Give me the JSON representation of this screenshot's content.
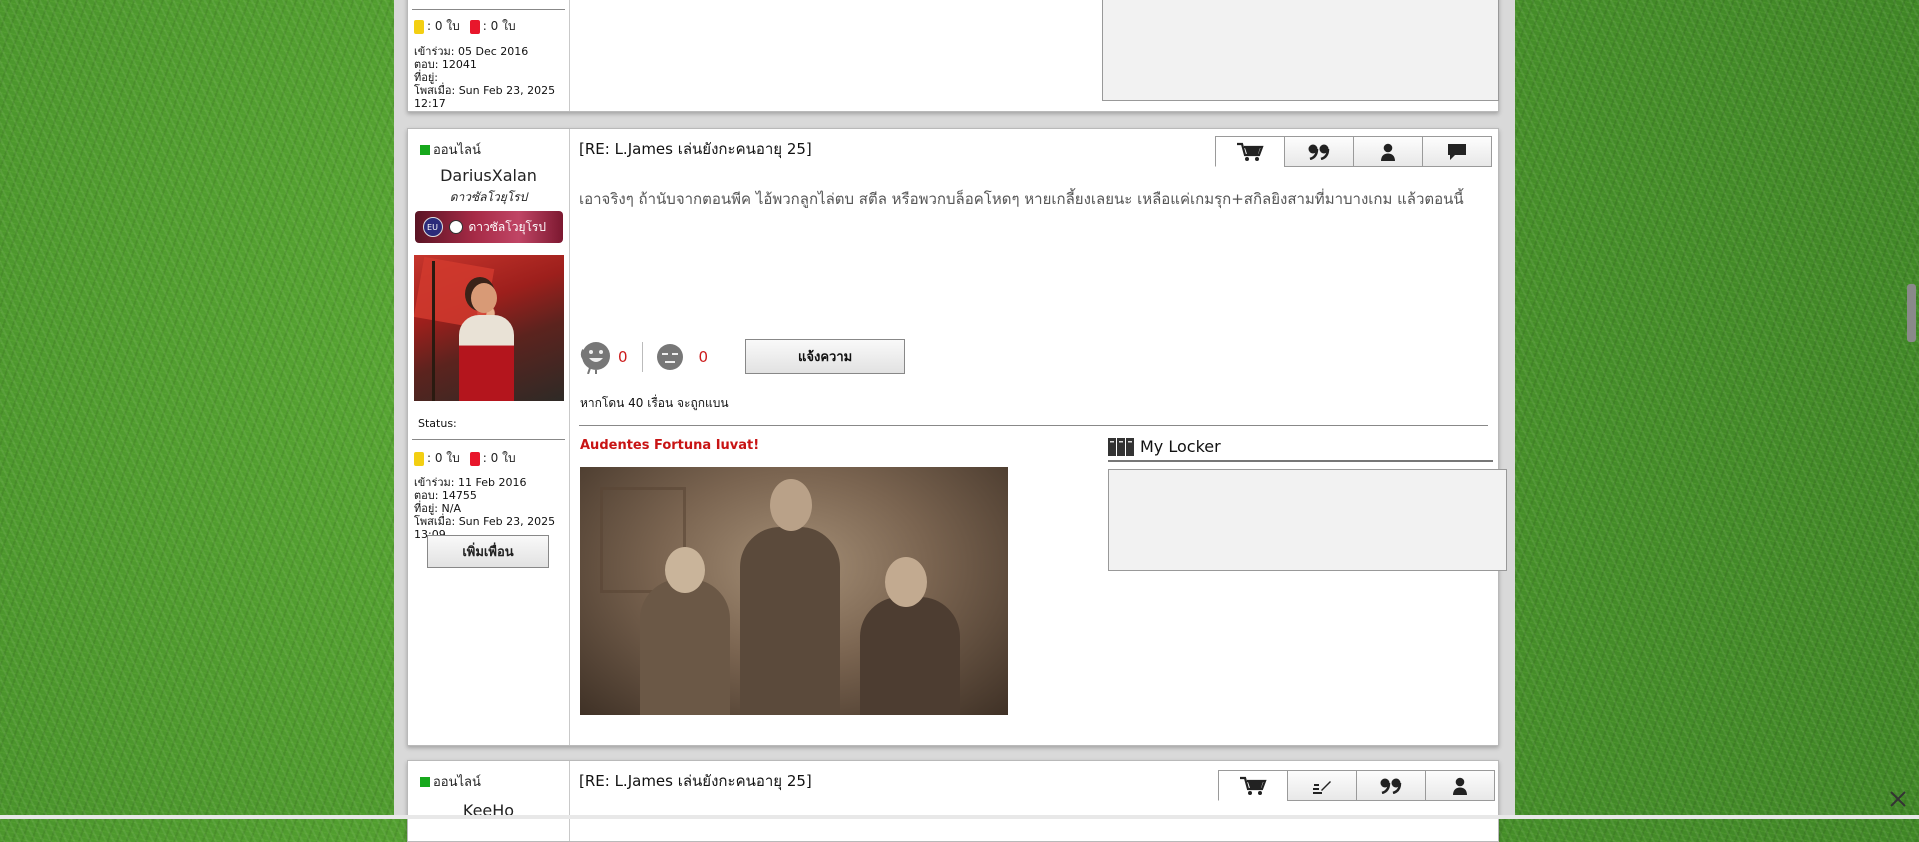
{
  "post_top": {
    "yellow_cards": ": 0 ใบ",
    "red_cards": ": 0 ใบ",
    "joined": "เข้าร่วม: 05 Dec 2016",
    "replies": "ตอบ: 12041",
    "location": "ที่อยู่:",
    "posted": "โพสเมื่อ: Sun Feb 23, 2025 12:17"
  },
  "post_main": {
    "online_label": "ออนไลน์",
    "username": "DariusXalan",
    "rank": "ดาวซัลโวยุโรป",
    "badge_eu": "EU",
    "badge_text": "ดาวซัลโวยุโรป",
    "status_label": "Status:",
    "yellow_cards": ": 0 ใบ",
    "red_cards": ": 0 ใบ",
    "joined": "เข้าร่วม: 11 Feb 2016",
    "replies": "ตอบ: 14755",
    "location": "ที่อยู่: N/A",
    "posted": "โพสเมื่อ: Sun Feb 23, 2025 13:09",
    "add_friend": "เพิ่มเพื่อน",
    "title": "[RE: L.James เล่นยังกะคนอายุ 25]",
    "body": "เอาจริงๆ ถ้านับจากตอนพีค ไอ้พวกลูกไล่ตบ สตีล หรือพวกบล็อคโหดๆ หายเกลี้ยงเลยนะ เหลือแค่เกมรุก+สกิลยิงสามที่มาบางเกม แล้วตอนนี้",
    "like_count": "0",
    "dislike_count": "0",
    "report_label": "แจ้งความ",
    "warn_text": "หากโดน 40 เรื่อน จะถูกแบน",
    "signature_title": "Audentes Fortuna Iuvat!",
    "locker_title": "My Locker"
  },
  "post_bottom": {
    "online_label": "ออนไลน์",
    "username": "KeeHo",
    "title": "[RE: L.James เล่นยังกะคนอายุ 25]"
  },
  "icons": {
    "cart": "cart-icon",
    "quote": "quote-icon",
    "user": "user-icon",
    "message": "message-icon",
    "edit": "edit-icon",
    "close": "close-icon"
  },
  "colors": {
    "online": "#17a81c",
    "count_red": "#cc1b1b",
    "signature_red": "#c81414",
    "yellow_card": "#f3cf12",
    "red_card": "#e8162b"
  }
}
